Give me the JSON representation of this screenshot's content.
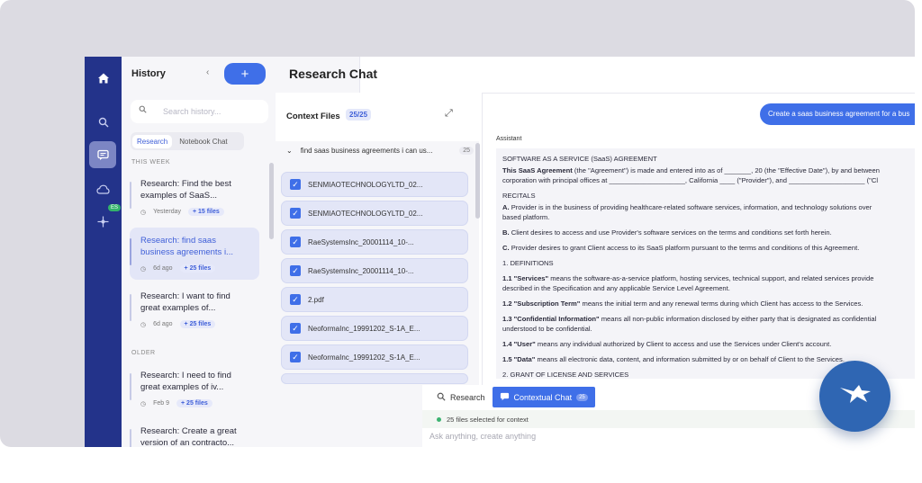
{
  "sidebar_rail": {
    "icons": [
      "home-icon",
      "search-icon",
      "chat-icon",
      "cloud-icon",
      "crosshair-icon"
    ],
    "badge": "ES"
  },
  "history": {
    "title": "History",
    "search_placeholder": "Search history...",
    "tabs": [
      {
        "label": "Research",
        "active": true
      },
      {
        "label": "Notebook Chat",
        "active": false
      }
    ],
    "sections": [
      {
        "label": "THIS WEEK",
        "items": [
          {
            "title": "Research: Find the best examples of SaaS...",
            "date": "Yesterday",
            "files": "+ 15 files",
            "active": false
          },
          {
            "title": "Research: find saas business agreements i...",
            "date": "6d ago",
            "files": "+ 25 files",
            "active": true
          },
          {
            "title": "Research: I want to find great examples of...",
            "date": "6d ago",
            "files": "+ 25 files",
            "active": false
          }
        ]
      },
      {
        "label": "OLDER",
        "items": [
          {
            "title": "Research: I need to find great examples of iv...",
            "date": "Feb 9",
            "files": "+ 25 files",
            "active": false
          },
          {
            "title": "Research: Create a great version of an contracto...",
            "date": "",
            "files": "",
            "active": false
          }
        ]
      }
    ]
  },
  "main": {
    "title": "Research Chat"
  },
  "context": {
    "title": "Context Files",
    "count": "25/25",
    "group_label": "find saas business agreements i can us...",
    "group_count": "25",
    "files": [
      "SENMIAOTECHNOLOGYLTD_02...",
      "SENMIAOTECHNOLOGYLTD_02...",
      "RaeSystemsInc_20001114_10-...",
      "RaeSystemsInc_20001114_10-...",
      "2.pdf",
      "NeoformaInc_19991202_S-1A_E...",
      "NeoformaInc_19991202_S-1A_E..."
    ]
  },
  "chat": {
    "user_message": "Create a saas business agreement for a bus",
    "assistant_label": "Assistant",
    "doc": {
      "heading": "SOFTWARE AS A SERVICE (SaaS) AGREEMENT",
      "intro_bold": "This SaaS Agreement",
      "intro_rest": " (the \"Agreement\") is made and entered into as of _______, 20 (the \"Effective Date\"), by and between",
      "intro_line2": "corporation with principal offices at ____________________, California ____ (\"Provider\"), and ____________________ (\"Cl",
      "recitals": "RECITALS",
      "recital_a_bold": "A.",
      "recital_a": " Provider is in the business of providing healthcare-related software services, information, and technology solutions over",
      "recital_a2": "based platform.",
      "recital_b_bold": "B.",
      "recital_b": " Client desires to access and use Provider's software services on the terms and conditions set forth herein.",
      "recital_c_bold": "C.",
      "recital_c": " Provider desires to grant Client access to its SaaS platform pursuant to the terms and conditions of this Agreement.",
      "definitions": "1. DEFINITIONS",
      "d1_bold": "1.1 \"Services\"",
      "d1": " means the software-as-a-service platform, hosting services, technical support, and related services provide",
      "d1b": "described in the Specification and any applicable Service Level Agreement.",
      "d2_bold": "1.2 \"Subscription Term\"",
      "d2": " means the initial term and any renewal terms during which Client has access to the Services.",
      "d3_bold": "1.3 \"Confidential Information\"",
      "d3": " means all non-public information disclosed by either party that is designated as confidential",
      "d3b": "understood to be confidential.",
      "d4_bold": "1.4 \"User\"",
      "d4": " means any individual authorized by Client to access and use the Services under Client's account.",
      "d5_bold": "1.5 \"Data\"",
      "d5": " means all electronic data, content, and information submitted by or on behalf of Client to the Services.",
      "grant": "2. GRANT OF LICENSE AND SERVICES"
    }
  },
  "composer": {
    "tabs": [
      {
        "label": "Research",
        "active": false
      },
      {
        "label": "Contextual Chat",
        "active": true,
        "count": "25"
      }
    ],
    "selected_info": "25 files selected for context",
    "placeholder": "Ask anything, create anything"
  },
  "colors": {
    "accent": "#3f6fe8",
    "rail": "#23338a",
    "fab": "#2f66b3"
  }
}
